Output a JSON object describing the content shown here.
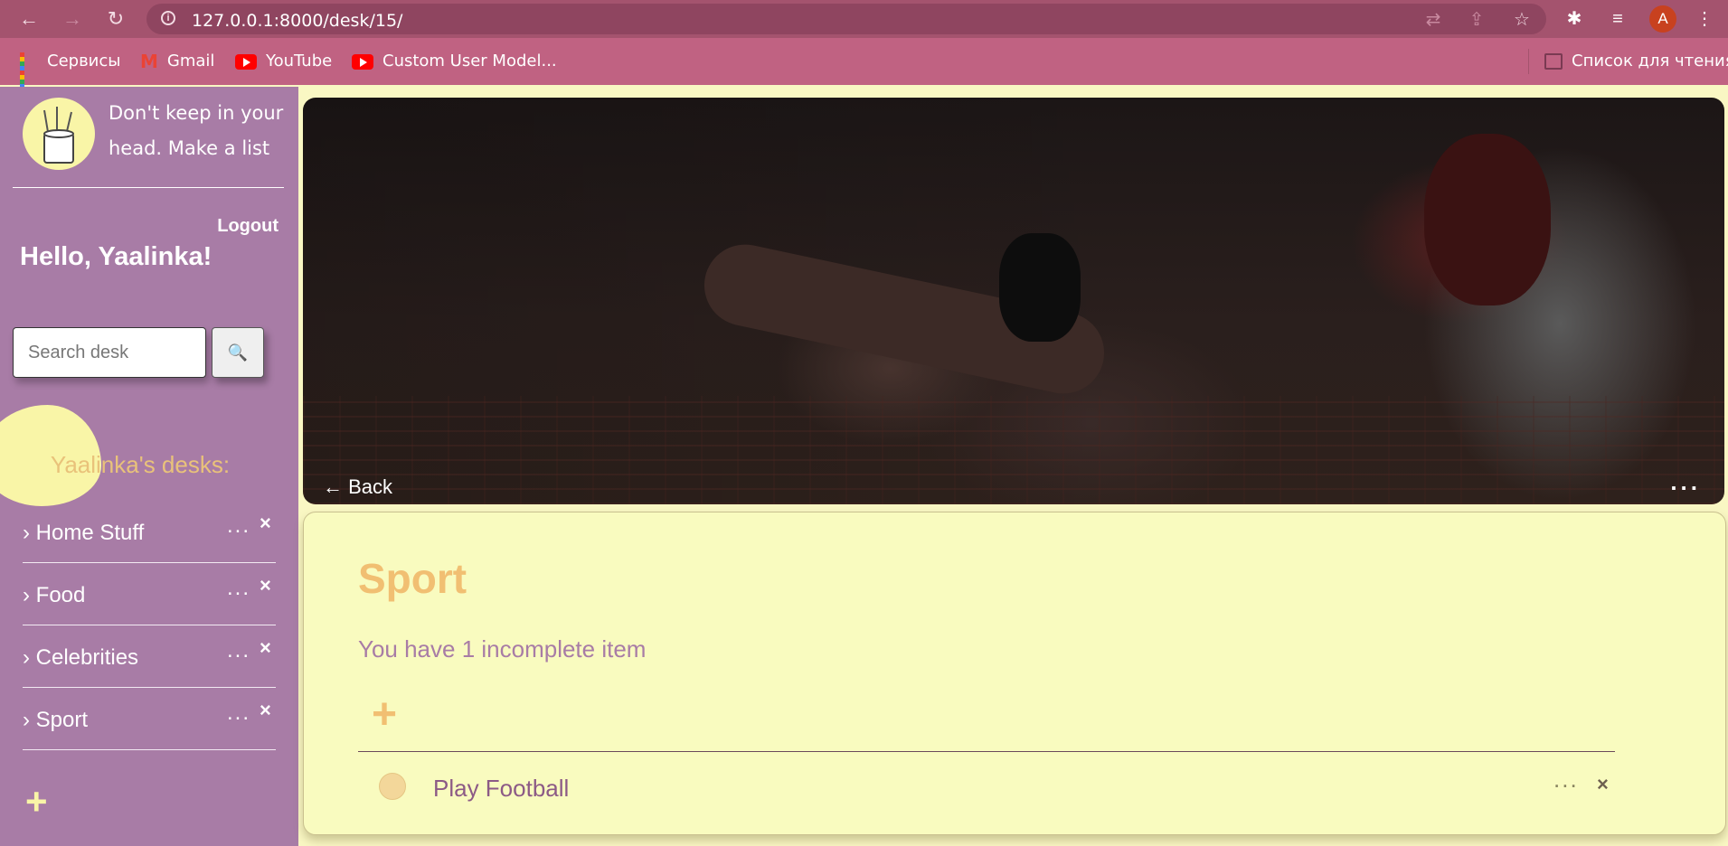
{
  "browser": {
    "url": "127.0.0.1:8000/desk/15/",
    "avatar_letter": "A",
    "bookmarks": [
      {
        "label": "Сервисы",
        "icon": "apps-grid-icon"
      },
      {
        "label": "Gmail",
        "icon": "gmail-icon"
      },
      {
        "label": "YouTube",
        "icon": "youtube-icon"
      },
      {
        "label": "Custom User Model...",
        "icon": "youtube-icon"
      }
    ],
    "reading_list": "Список для чтения"
  },
  "sidebar": {
    "tagline": "Don't keep in your head. Make a list",
    "logout": "Logout",
    "greeting": "Hello, Yaalinka!",
    "search_placeholder": "Search desk",
    "search_icon": "🔍",
    "desks_title": "Yaalinka's desks:",
    "desks": [
      {
        "label": "› Home Stuff"
      },
      {
        "label": "› Food"
      },
      {
        "label": "› Celebrities"
      },
      {
        "label": "› Sport"
      }
    ],
    "item_menu": "...",
    "item_delete": "×",
    "add": "+"
  },
  "main": {
    "back": "← Back",
    "banner_menu": "...",
    "desk_title": "Sport",
    "incomplete_text": "You have 1 incomplete item",
    "add": "+",
    "items": [
      {
        "label": "Play Football",
        "menu": "...",
        "delete": "×"
      }
    ]
  },
  "colors": {
    "chrome": "#a4536e",
    "bookmarks_bar": "#c06282",
    "sidebar": "#a87ca6",
    "accent_yellow": "#f9f5a7",
    "title_orange": "#f1bf72",
    "card_bg": "#f9fbbf"
  }
}
